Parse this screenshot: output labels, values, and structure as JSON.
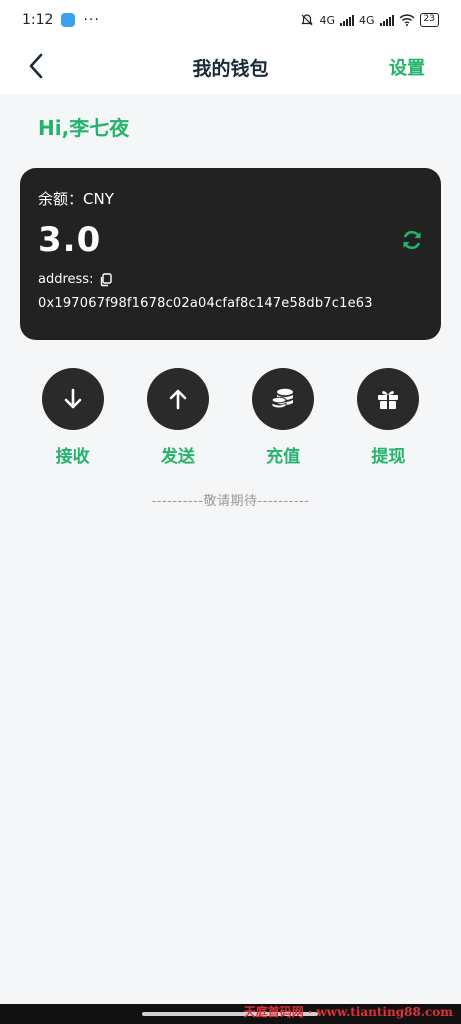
{
  "status_bar": {
    "time": "1:12",
    "more": "···",
    "network_1": "4G",
    "network_2": "4G",
    "battery": "23"
  },
  "header": {
    "title": "我的钱包",
    "settings_label": "设置"
  },
  "greeting": "Hi,李七夜",
  "wallet": {
    "balance_label": "余额：CNY",
    "balance_value": "3.0",
    "address_label": "address:",
    "address_value": "0x197067f98f1678c02a04cfaf8c147e58db7c1e63"
  },
  "actions": [
    {
      "label": "接收",
      "icon": "arrow-down-icon"
    },
    {
      "label": "发送",
      "icon": "arrow-up-icon"
    },
    {
      "label": "充值",
      "icon": "coins-icon"
    },
    {
      "label": "提现",
      "icon": "gift-icon"
    }
  ],
  "coming_soon": "----------敬请期待----------",
  "watermark": "天庭首码网 · www.tianting88.com",
  "colors": {
    "accent": "#24b36b",
    "card": "#222222",
    "background": "#f5f6f8"
  }
}
